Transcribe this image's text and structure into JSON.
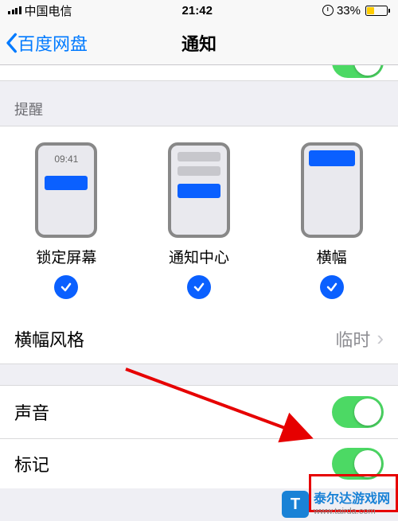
{
  "statusBar": {
    "carrier": "中国电信",
    "time": "21:42",
    "batteryPercent": "33%"
  },
  "nav": {
    "back": "百度网盘",
    "title": "通知"
  },
  "sections": {
    "alertsHeader": "提醒",
    "lockScreen": "锁定屏幕",
    "notificationCenter": "通知中心",
    "banners": "横幅",
    "lockTime": "09:41"
  },
  "bannerStyle": {
    "label": "横幅风格",
    "value": "临时"
  },
  "sounds": {
    "label": "声音"
  },
  "badges": {
    "label": "标记"
  },
  "watermark": {
    "name": "泰尔达游戏网",
    "url": "www.tairda.com",
    "logoLetter": "T"
  }
}
